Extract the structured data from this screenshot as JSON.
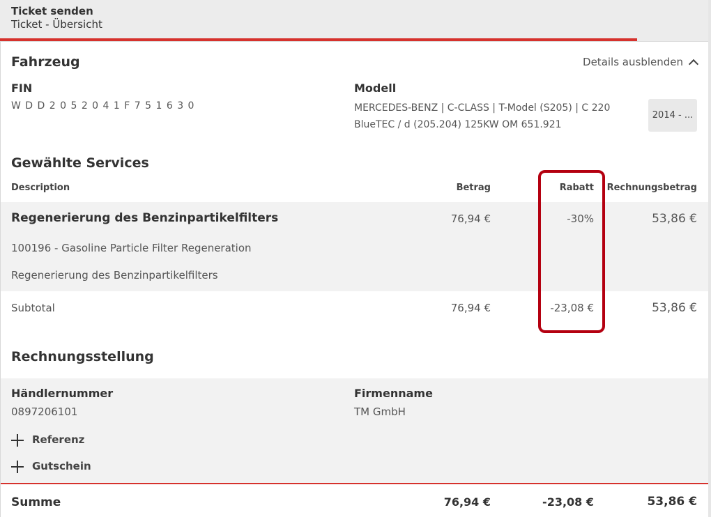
{
  "header": {
    "title": "Ticket senden",
    "subtitle": "Ticket - Übersicht"
  },
  "progress": {
    "fraction": 0.9
  },
  "vehicle": {
    "section_title": "Fahrzeug",
    "details_toggle": "Details ausblenden",
    "fin_label": "FIN",
    "fin_value": "W D D 2 0 5 2 0 4 1 F 7 5 1 6 3 0",
    "model_label": "Modell",
    "model_value": "MERCEDES-BENZ | C-CLASS | T-Model (S205) | C 220 BlueTEC / d (205.204) 125KW OM 651.921",
    "year_button": "2014 - ..."
  },
  "services": {
    "section_title": "Gewählte Services",
    "columns": {
      "description": "Description",
      "amount": "Betrag",
      "discount": "Rabatt",
      "invoice": "Rechnungsbetrag"
    },
    "item": {
      "title": "Regenerierung des Benzinpartikelfilters",
      "amount": "76,94 €",
      "discount": "-30%",
      "invoice": "53,86 €",
      "code_line": "100196 - Gasoline Particle Filter Regeneration",
      "desc_line": "Regenerierung des Benzinpartikelfilters"
    },
    "subtotal": {
      "label": "Subtotal",
      "amount": "76,94 €",
      "discount": "-23,08 €",
      "invoice": "53,86 €"
    }
  },
  "billing": {
    "section_title": "Rechnungsstellung",
    "dealer_label": "Händlernummer",
    "dealer_value": "0897206101",
    "company_label": "Firmenname",
    "company_value": "TM GmbH",
    "add_reference": "Referenz",
    "add_voucher": "Gutschein"
  },
  "total": {
    "label": "Summe",
    "amount": "76,94 €",
    "discount": "-23,08 €",
    "invoice": "53,86 €"
  },
  "colors": {
    "accent": "#d6322d",
    "highlight": "#b40010",
    "band": "#f2f2f2"
  }
}
